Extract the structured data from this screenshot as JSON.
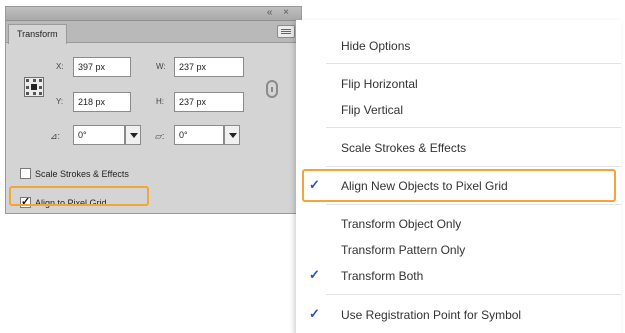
{
  "panel": {
    "tab_label": "Transform",
    "window_controls": "« ×",
    "x_label": "X:",
    "x_value": "397 px",
    "y_label": "Y:",
    "y_value": "218 px",
    "w_label": "W:",
    "w_value": "237 px",
    "h_label": "H:",
    "h_value": "237 px",
    "angle_value": "0°",
    "shear_value": "0°",
    "scale_strokes_label": "Scale Strokes & Effects",
    "scale_strokes_checked": false,
    "align_pixel_grid_label": "Align to Pixel Grid",
    "align_pixel_grid_checked": true,
    "highlight_color": "#f0a63b"
  },
  "menu": {
    "items": [
      {
        "label": "Hide Options",
        "checked": false
      },
      {
        "label": "Flip Horizontal",
        "checked": false
      },
      {
        "label": "Flip Vertical",
        "checked": false
      },
      {
        "label": "Scale Strokes & Effects",
        "checked": false
      },
      {
        "label": "Align New Objects to Pixel Grid",
        "checked": true
      },
      {
        "label": "Transform Object Only",
        "checked": false
      },
      {
        "label": "Transform Pattern Only",
        "checked": false
      },
      {
        "label": "Transform Both",
        "checked": true
      },
      {
        "label": "Use Registration Point for Symbol",
        "checked": true
      }
    ],
    "check_glyph": "✓",
    "check_color": "#2a55b8"
  }
}
